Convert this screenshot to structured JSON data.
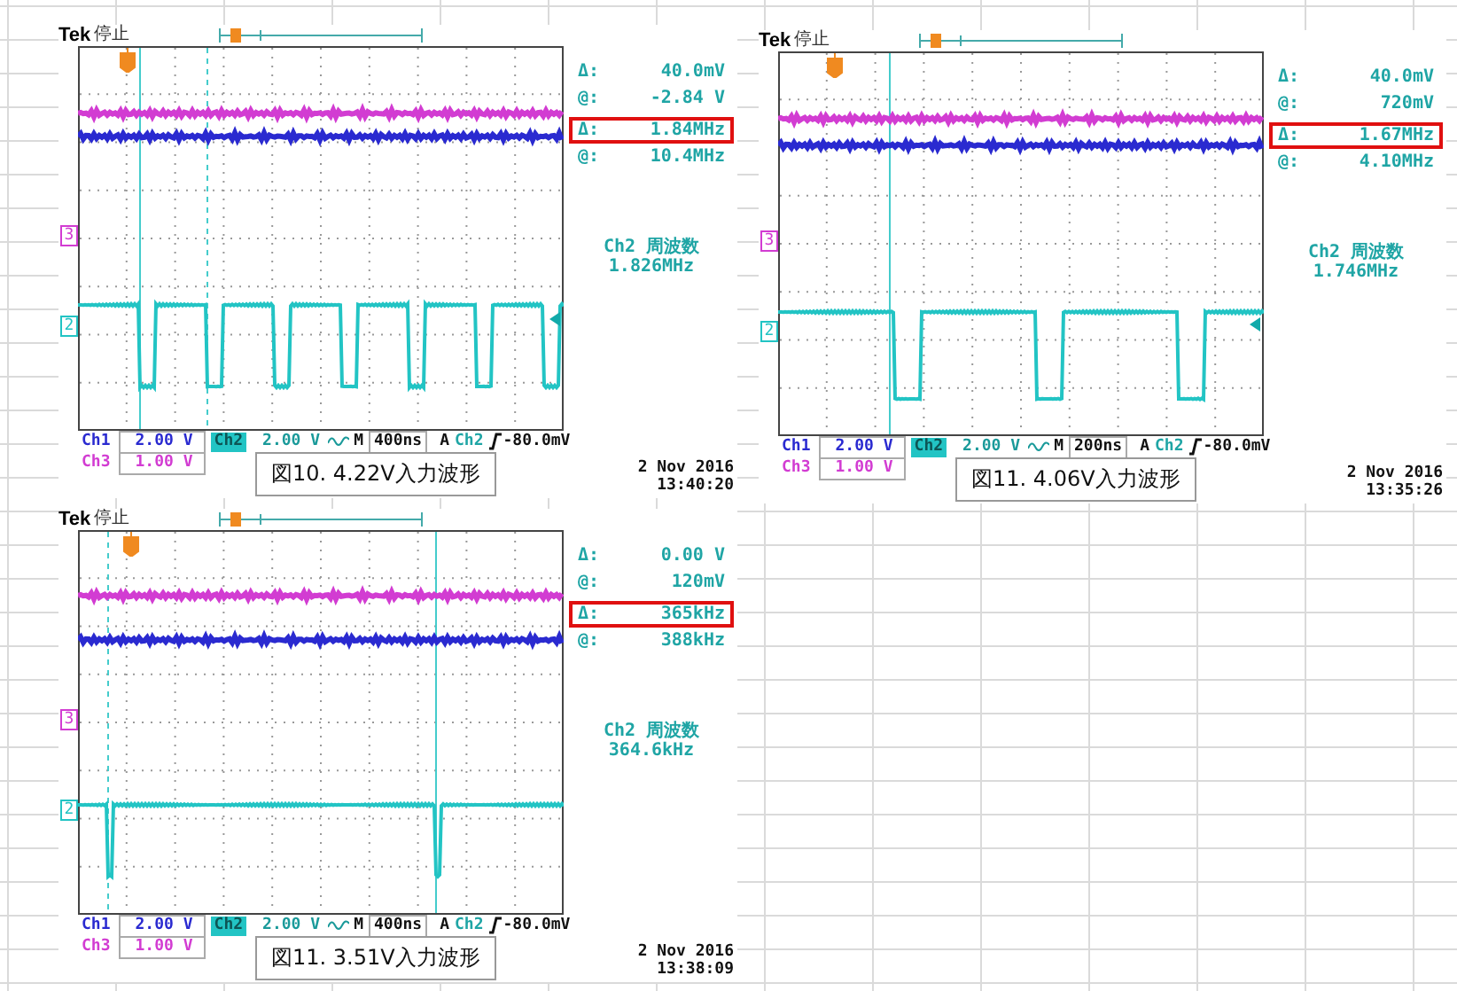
{
  "scopes": [
    {
      "brand": "Tek",
      "status": "停止",
      "readouts": [
        {
          "symbol": "Δ:",
          "value": "40.0mV",
          "highlighted": false
        },
        {
          "symbol": "@:",
          "value": "-2.84 V",
          "highlighted": false
        },
        {
          "symbol": "Δ:",
          "value": "1.84MHz",
          "highlighted": true
        },
        {
          "symbol": "@:",
          "value": "10.4MHz",
          "highlighted": false
        }
      ],
      "measurement": {
        "label": "Ch2 周波数",
        "value": "1.826MHz"
      },
      "channels": [
        {
          "name": "Ch1",
          "scale": "2.00 V",
          "color": "#2a2ad0",
          "selected": false
        },
        {
          "name": "Ch2",
          "scale": "2.00 V",
          "color": "#22c4c4",
          "selected": true
        },
        {
          "name": "Ch3",
          "scale": "1.00 V",
          "color": "#d23cd2",
          "selected": false
        }
      ],
      "timebase": {
        "label": "M",
        "value": "400ns"
      },
      "trigger": {
        "mode": "A",
        "source": "Ch2",
        "level": "-80.0mV"
      },
      "ground_markers": [
        {
          "label": "3",
          "color": "#d23cd2"
        },
        {
          "label": "2",
          "color": "#22c4c4"
        }
      ],
      "caption": "図10. 4.22V入力波形",
      "date": "2 Nov 2016",
      "time": "13:40:20"
    },
    {
      "brand": "Tek",
      "status": "停止",
      "readouts": [
        {
          "symbol": "Δ:",
          "value": "40.0mV",
          "highlighted": false
        },
        {
          "symbol": "@:",
          "value": "720mV",
          "highlighted": false
        },
        {
          "symbol": "Δ:",
          "value": "1.67MHz",
          "highlighted": true
        },
        {
          "symbol": "@:",
          "value": "4.10MHz",
          "highlighted": false
        }
      ],
      "measurement": {
        "label": "Ch2 周波数",
        "value": "1.746MHz"
      },
      "channels": [
        {
          "name": "Ch1",
          "scale": "2.00 V",
          "color": "#2a2ad0",
          "selected": false
        },
        {
          "name": "Ch2",
          "scale": "2.00 V",
          "color": "#22c4c4",
          "selected": true
        },
        {
          "name": "Ch3",
          "scale": "1.00 V",
          "color": "#d23cd2",
          "selected": false
        }
      ],
      "timebase": {
        "label": "M",
        "value": "200ns"
      },
      "trigger": {
        "mode": "A",
        "source": "Ch2",
        "level": "-80.0mV"
      },
      "ground_markers": [
        {
          "label": "3",
          "color": "#d23cd2"
        },
        {
          "label": "2",
          "color": "#22c4c4"
        }
      ],
      "caption": "図11. 4.06V入力波形",
      "date": "2 Nov 2016",
      "time": "13:35:26"
    },
    {
      "brand": "Tek",
      "status": "停止",
      "readouts": [
        {
          "symbol": "Δ:",
          "value": "0.00 V",
          "highlighted": false
        },
        {
          "symbol": "@:",
          "value": "120mV",
          "highlighted": false
        },
        {
          "symbol": "Δ:",
          "value": "365kHz",
          "highlighted": true
        },
        {
          "symbol": "@:",
          "value": "388kHz",
          "highlighted": false
        }
      ],
      "measurement": {
        "label": "Ch2 周波数",
        "value": "364.6kHz"
      },
      "channels": [
        {
          "name": "Ch1",
          "scale": "2.00 V",
          "color": "#2a2ad0",
          "selected": false
        },
        {
          "name": "Ch2",
          "scale": "2.00 V",
          "color": "#22c4c4",
          "selected": true
        },
        {
          "name": "Ch3",
          "scale": "1.00 V",
          "color": "#d23cd2",
          "selected": false
        }
      ],
      "timebase": {
        "label": "M",
        "value": "400ns"
      },
      "trigger": {
        "mode": "A",
        "source": "Ch2",
        "level": "-80.0mV"
      },
      "ground_markers": [
        {
          "label": "3",
          "color": "#d23cd2"
        },
        {
          "label": "2",
          "color": "#22c4c4"
        }
      ],
      "caption": "図11. 3.51V入力波形",
      "date": "2 Nov 2016",
      "time": "13:38:09"
    }
  ]
}
